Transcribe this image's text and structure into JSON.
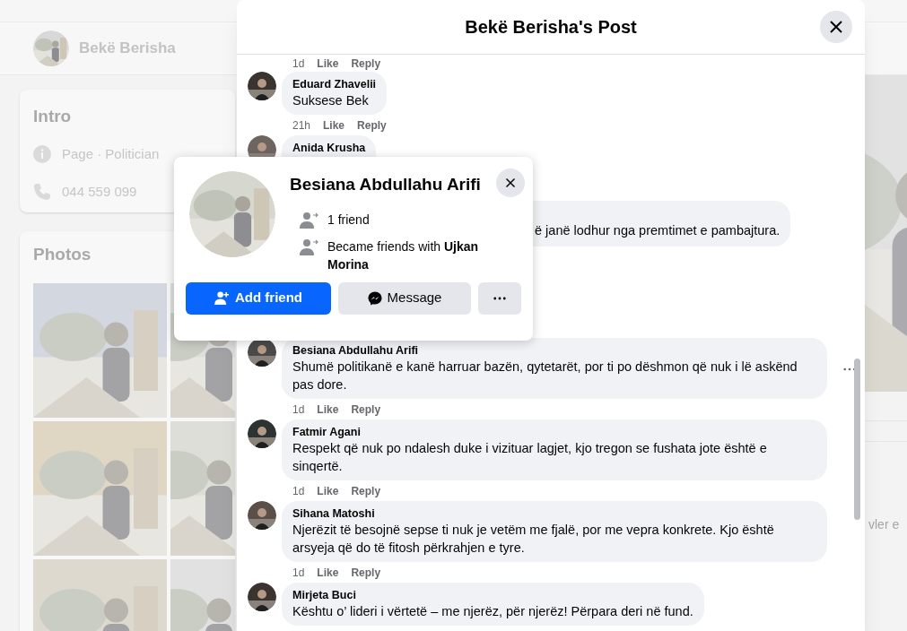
{
  "page": {
    "header": {
      "name": "Bekë Berisha"
    },
    "intro": {
      "title": "Intro",
      "items": [
        {
          "kind": "info",
          "text": "Page · Politician"
        },
        {
          "kind": "phone",
          "text": "044 559 099"
        }
      ]
    },
    "photos": {
      "title": "Photos"
    },
    "side_text": "vler e"
  },
  "modal": {
    "title": "Bekë Berisha's Post",
    "top_actions": {
      "time": "1d",
      "like": "Like",
      "reply": "Reply"
    },
    "comments": [
      {
        "author": "Eduard Zhavelii",
        "text": "Suksese Bek",
        "show_menu": false,
        "actions": {
          "time": "21h",
          "like": "Like",
          "reply": "Reply"
        }
      },
      {
        "author": "Anida Krusha",
        "show_menu": false
      },
      {
        "text": "ë janë lodhur nga premtimet e pambajtura.",
        "show_menu": false
      },
      {
        "author": "Besiana Abdullahu Arifi",
        "text": "Shumë politikanë e kanë harruar bazën, qytetarët, por ti po dëshmon që nuk i lë askënd pas dore.",
        "show_menu": true,
        "actions": {
          "time": "1d",
          "like": "Like",
          "reply": "Reply"
        }
      },
      {
        "author": "Fatmir Agani",
        "text": "Respekt që nuk po ndalesh duke i vizituar lagjet, kjo tregon se fushata jote është e sinqertë.",
        "show_menu": false,
        "actions": {
          "time": "1d",
          "like": "Like",
          "reply": "Reply"
        }
      },
      {
        "author": "Sihana Matoshi",
        "text": "Njerëzit të besojnë sepse ti nuk je vetëm me fjalë, por me vepra konkrete. Kjo është arsyeja që do të fitosh përkrahjen e tyre.",
        "show_menu": false,
        "actions": {
          "time": "1d",
          "like": "Like",
          "reply": "Reply"
        }
      },
      {
        "author": "Mirjeta Buci",
        "text": "Kështu o’ lideri i vërtetë – me njerëz, për njerëz! Përpara deri në fund.",
        "show_menu": false
      }
    ]
  },
  "profile_card": {
    "name": "Besiana Abdullahu Arifi",
    "lines": [
      {
        "text": "1 friend"
      },
      {
        "text": "Became friends with **Ujkan Morina**"
      }
    ],
    "buttons": [
      {
        "kind": "primary",
        "label": "Add friend"
      },
      {
        "kind": "secondary",
        "label": "Message"
      },
      {
        "kind": "more"
      }
    ]
  }
}
